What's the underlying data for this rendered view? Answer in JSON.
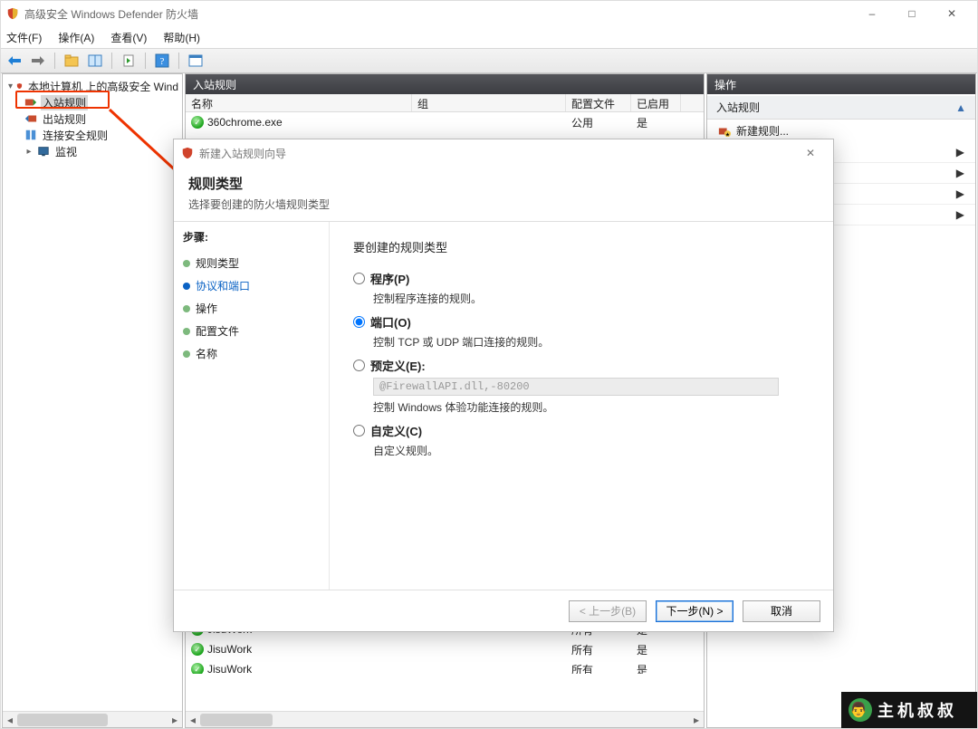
{
  "window": {
    "title": "高级安全 Windows Defender 防火墙"
  },
  "menu": {
    "file": "文件(F)",
    "action": "操作(A)",
    "view": "查看(V)",
    "help": "帮助(H)"
  },
  "tree": {
    "root": "本地计算机 上的高级安全 Wind",
    "inbound": "入站规则",
    "outbound": "出站规则",
    "connsec": "连接安全规则",
    "monitor": "监视"
  },
  "center": {
    "header": "入站规则",
    "cols": {
      "name": "名称",
      "group": "组",
      "profile": "配置文件",
      "enabled": "已启用"
    },
    "rows": [
      {
        "name": "360chrome.exe",
        "profile": "公用",
        "enabled": "是"
      },
      {
        "name": "JisuWork",
        "profile": "所有",
        "enabled": "是"
      },
      {
        "name": "JisuWork",
        "profile": "所有",
        "enabled": "是"
      },
      {
        "name": "JisuWork",
        "profile": "所有",
        "enabled": "是"
      }
    ]
  },
  "right": {
    "header": "操作",
    "section": "入站规则",
    "new_rule": "新建规则..."
  },
  "dialog": {
    "title": "新建入站规则向导",
    "head": "规则类型",
    "head_sub": "选择要创建的防火墙规则类型",
    "steps_title": "步骤:",
    "steps": {
      "type": "规则类型",
      "proto": "协议和端口",
      "action": "操作",
      "profile": "配置文件",
      "name": "名称"
    },
    "question": "要创建的规则类型",
    "opt_program": "程序(P)",
    "opt_program_desc": "控制程序连接的规则。",
    "opt_port": "端口(O)",
    "opt_port_desc": "控制 TCP 或 UDP 端口连接的规则。",
    "opt_predef": "预定义(E):",
    "opt_predef_value": "@FirewallAPI.dll,-80200",
    "opt_predef_desc": "控制 Windows 体验功能连接的规则。",
    "opt_custom": "自定义(C)",
    "opt_custom_desc": "自定义规则。",
    "btn_back": "< 上一步(B)",
    "btn_next": "下一步(N) >",
    "btn_cancel": "取消"
  },
  "watermark": "主机叔叔"
}
